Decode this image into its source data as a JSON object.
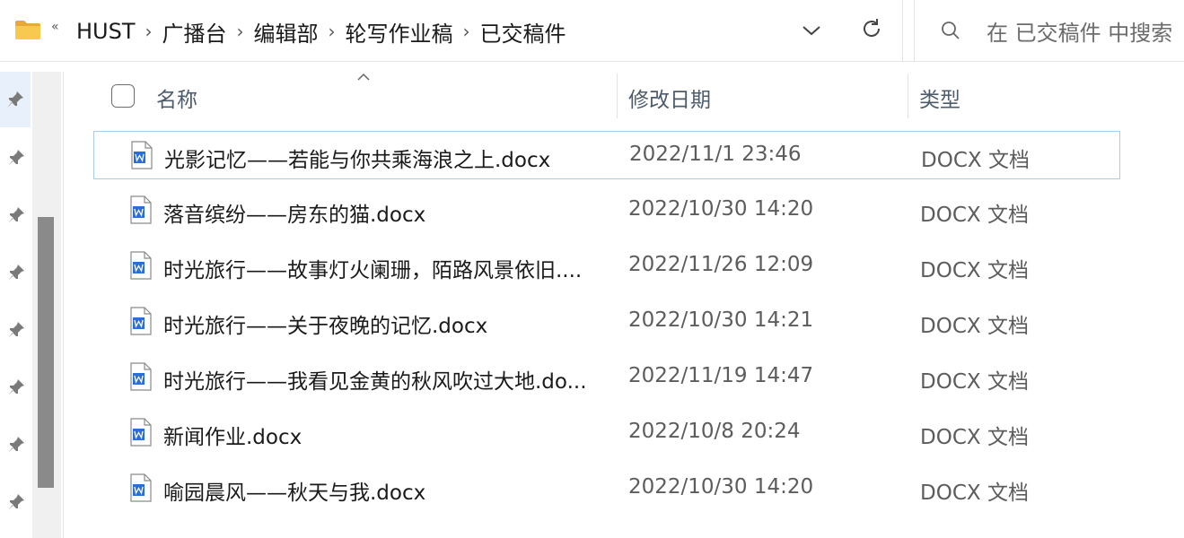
{
  "address": {
    "overflow": "«",
    "crumbs": [
      "HUST",
      "广播台",
      "编辑部",
      "轮写作业稿",
      "已交稿件"
    ],
    "separator": "›"
  },
  "search": {
    "placeholder": "在 已交稿件 中搜索"
  },
  "columns": {
    "name": "名称",
    "modified": "修改日期",
    "type": "类型"
  },
  "files": [
    {
      "name": "光影记忆——若能与你共乘海浪之上.docx",
      "date": "2022/11/1 23:46",
      "type": "DOCX 文档",
      "selected": true
    },
    {
      "name": "落音缤纷——房东的猫.docx",
      "date": "2022/10/30 14:20",
      "type": "DOCX 文档"
    },
    {
      "name": "时光旅行——故事灯火阑珊，陌路风景依旧....",
      "date": "2022/11/26 12:09",
      "type": "DOCX 文档"
    },
    {
      "name": "时光旅行——关于夜晚的记忆.docx",
      "date": "2022/10/30 14:21",
      "type": "DOCX 文档"
    },
    {
      "name": "时光旅行——我看见金黄的秋风吹过大地.do...",
      "date": "2022/11/19 14:47",
      "type": "DOCX 文档"
    },
    {
      "name": "新闻作业.docx",
      "date": "2022/10/8 20:24",
      "type": "DOCX 文档"
    },
    {
      "name": "喻园晨风——秋天与我.docx",
      "date": "2022/10/30 14:20",
      "type": "DOCX 文档"
    }
  ],
  "icons": {
    "folder": "folder-icon",
    "dropdown": "chevron-down-icon",
    "refresh": "refresh-icon",
    "search": "search-icon",
    "pin": "pin-icon",
    "file": "word-document-icon"
  },
  "colors": {
    "folder": "#f4c24d",
    "accent": "#2b6fd6",
    "selection_border": "#a8cce8"
  }
}
